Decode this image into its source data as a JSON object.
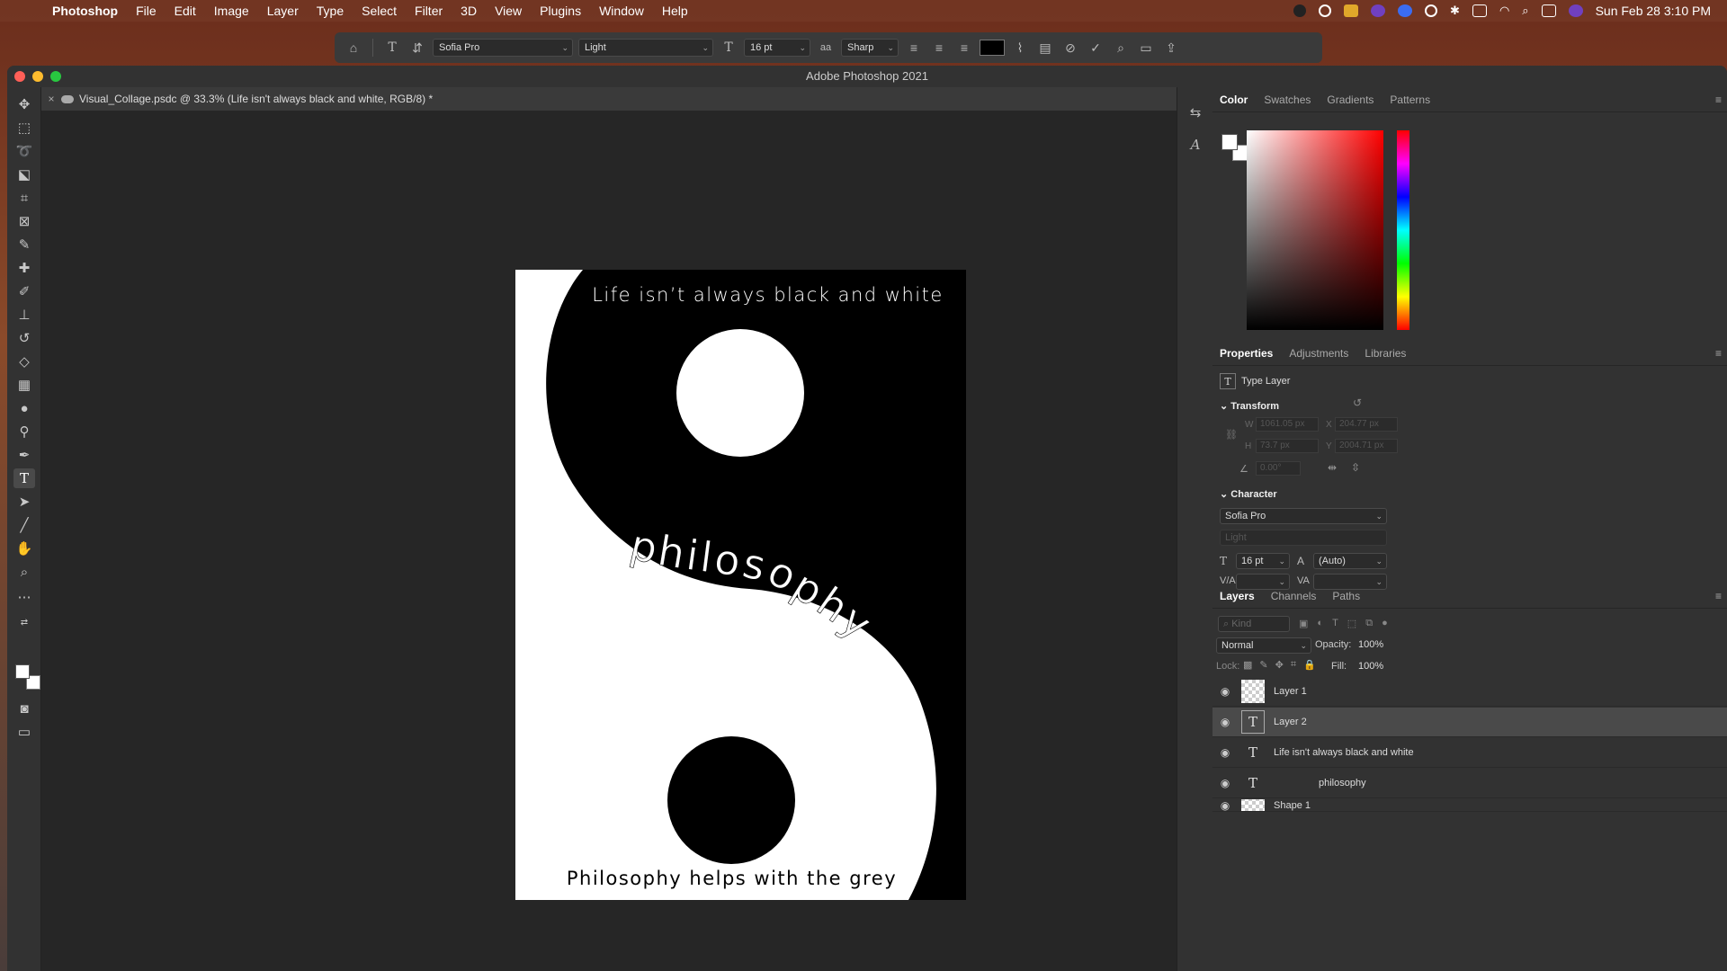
{
  "menubar": {
    "items": [
      "Photoshop",
      "File",
      "Edit",
      "Image",
      "Layer",
      "Type",
      "Select",
      "Filter",
      "3D",
      "View",
      "Plugins",
      "Window",
      "Help"
    ],
    "clock": "Sun Feb 28  3:10 PM"
  },
  "options_bar": {
    "font_family": "Sofia Pro",
    "font_style": "Light",
    "font_size": "16 pt",
    "antialias": "Sharp",
    "text_color": "#000000"
  },
  "window": {
    "title": "Adobe Photoshop 2021",
    "doc_tab": "Visual_Collage.psdc @ 33.3% (Life isn't always black and white, RGB/8) *"
  },
  "document": {
    "top_text": "Life isn’t always black and white",
    "curved_text": "philosophy",
    "bottom_text": "Philosophy helps with the grey"
  },
  "color_panel": {
    "tabs": [
      "Color",
      "Swatches",
      "Gradients",
      "Patterns"
    ],
    "active": "Color"
  },
  "properties_panel": {
    "tabs": [
      "Properties",
      "Adjustments",
      "Libraries"
    ],
    "active": "Properties",
    "layer_type": "Type Layer",
    "transform_label": "Transform",
    "w": "1061.05 px",
    "h": "73.7 px",
    "x": "204.77 px",
    "y": "2004.71 px",
    "angle": "0.00°",
    "character_label": "Character",
    "font_family": "Sofia Pro",
    "font_style": "Light",
    "font_size": "16 pt",
    "leading": "(Auto)"
  },
  "layers_panel": {
    "tabs": [
      "Layers",
      "Channels",
      "Paths"
    ],
    "active": "Layers",
    "filter_placeholder": "Kind",
    "blend_mode": "Normal",
    "opacity_label": "Opacity:",
    "opacity": "100%",
    "lock_label": "Lock:",
    "fill_label": "Fill:",
    "fill": "100%",
    "layers": [
      {
        "name": "Layer 1",
        "kind": "pixel",
        "selected": false
      },
      {
        "name": "Layer 2",
        "kind": "type",
        "selected": true
      },
      {
        "name": "Life isn't always black and white",
        "kind": "type",
        "selected": false
      },
      {
        "name": "philosophy",
        "kind": "type",
        "selected": false
      },
      {
        "name": "Shape 1",
        "kind": "pixel",
        "selected": false
      }
    ]
  }
}
